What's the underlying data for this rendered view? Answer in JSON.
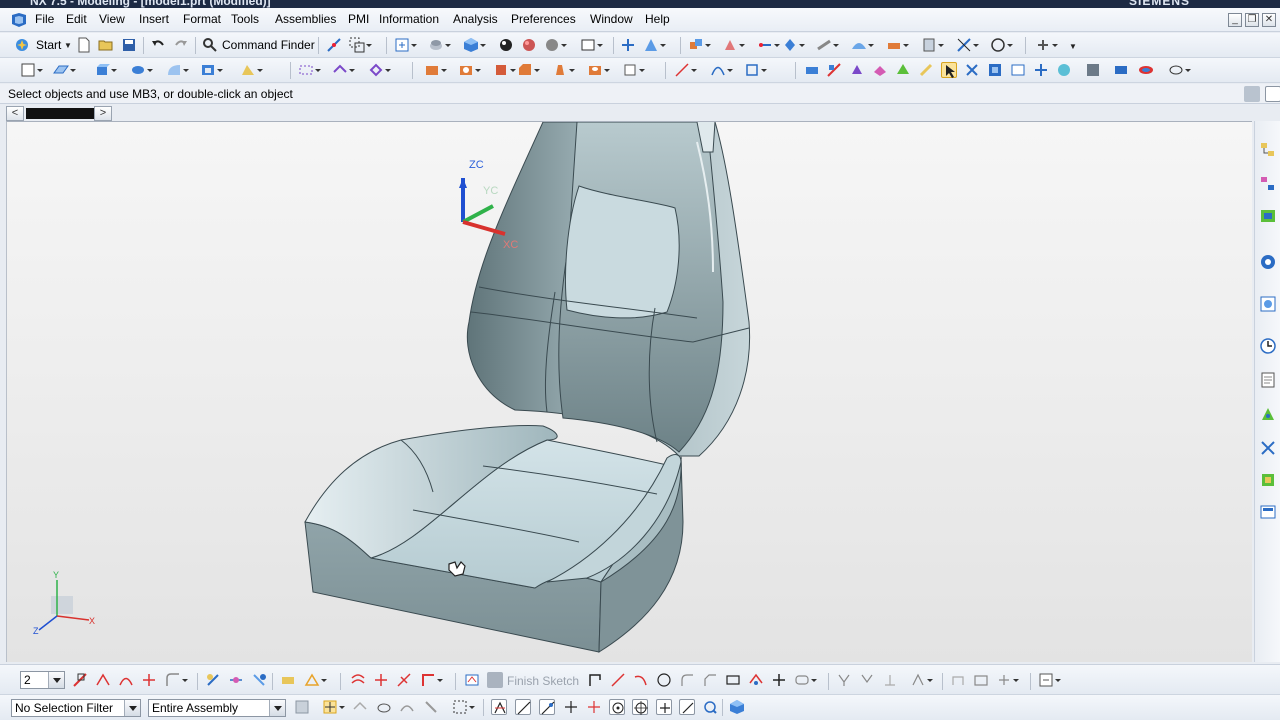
{
  "window": {
    "title": "NX 7.5 - Modeling - [model1.prt (Modified)]",
    "brand": "SIEMENS",
    "controls": [
      "_",
      "❐",
      "✕"
    ]
  },
  "menubar": {
    "items": [
      "File",
      "Edit",
      "View",
      "Insert",
      "Format",
      "Tools",
      "Assemblies",
      "PMI",
      "Information",
      "Analysis",
      "Preferences",
      "Window",
      "Help"
    ]
  },
  "standard_toolbar": {
    "start_label": "Start",
    "command_finder_label": "Command Finder"
  },
  "cue_line": {
    "text": "Select objects and use MB3, or double-click an object"
  },
  "resource_nav": {
    "left": "<",
    "right": ">"
  },
  "viewport": {
    "triad_labels": {
      "zc": "ZC",
      "yc": "YC",
      "xc": "XC"
    },
    "mini_triad_labels": {
      "y": "Y",
      "x": "X",
      "z": "Z"
    },
    "colors": {
      "background": "#ebebeb",
      "body_face": "#b9cfd6",
      "body_side": "#8fa3a8",
      "edge": "#3a4a50"
    }
  },
  "selection_bar": {
    "layer_value": "2",
    "finish_sketch_label": "Finish Sketch",
    "type_filter": "No Selection Filter",
    "scope": "Entire Assembly"
  },
  "colors": {
    "titlebar": "#1d2a44",
    "toolbar": "#e4eaf2",
    "accent_blue": "#2b6cc4"
  }
}
